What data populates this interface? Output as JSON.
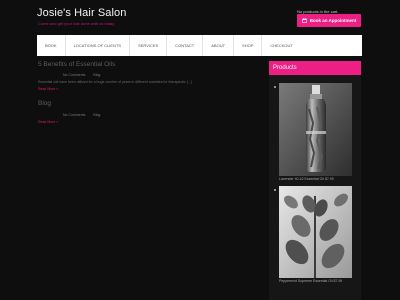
{
  "header": {
    "site_title": "Josie's Hair Salon",
    "tagline": "Come and get your hair done with us today",
    "cart_text": "No products in the cart.",
    "book_button_label": "Book an Appointment"
  },
  "nav": {
    "items": [
      "BOOK",
      "LOCATIONS OF CLIENTS",
      "SERVICES",
      "CONTACT",
      "ABOUT",
      "SHOP",
      "CHECKOUT"
    ]
  },
  "posts": [
    {
      "title": "5 Benefits of Essential Oils",
      "comments": "No Comments",
      "category": "Blog",
      "excerpt": "Essential oils have been utilized for a huge number of years in different societies for therapeutic [...]",
      "read_more": "Read More »"
    },
    {
      "title": "Blog",
      "comments": "No Comments",
      "category": "Blog",
      "read_more": "Read More »"
    }
  ],
  "sidebar": {
    "products_title": "Products",
    "products": [
      {
        "name": "Lavender 40-42 Essential Oil",
        "price": "$7.99"
      },
      {
        "name": "Peppermint Supreme Essential Oil",
        "price": "$7.99"
      }
    ]
  },
  "colors": {
    "accent": "#ee1f84",
    "background": "#0e0e0e"
  }
}
